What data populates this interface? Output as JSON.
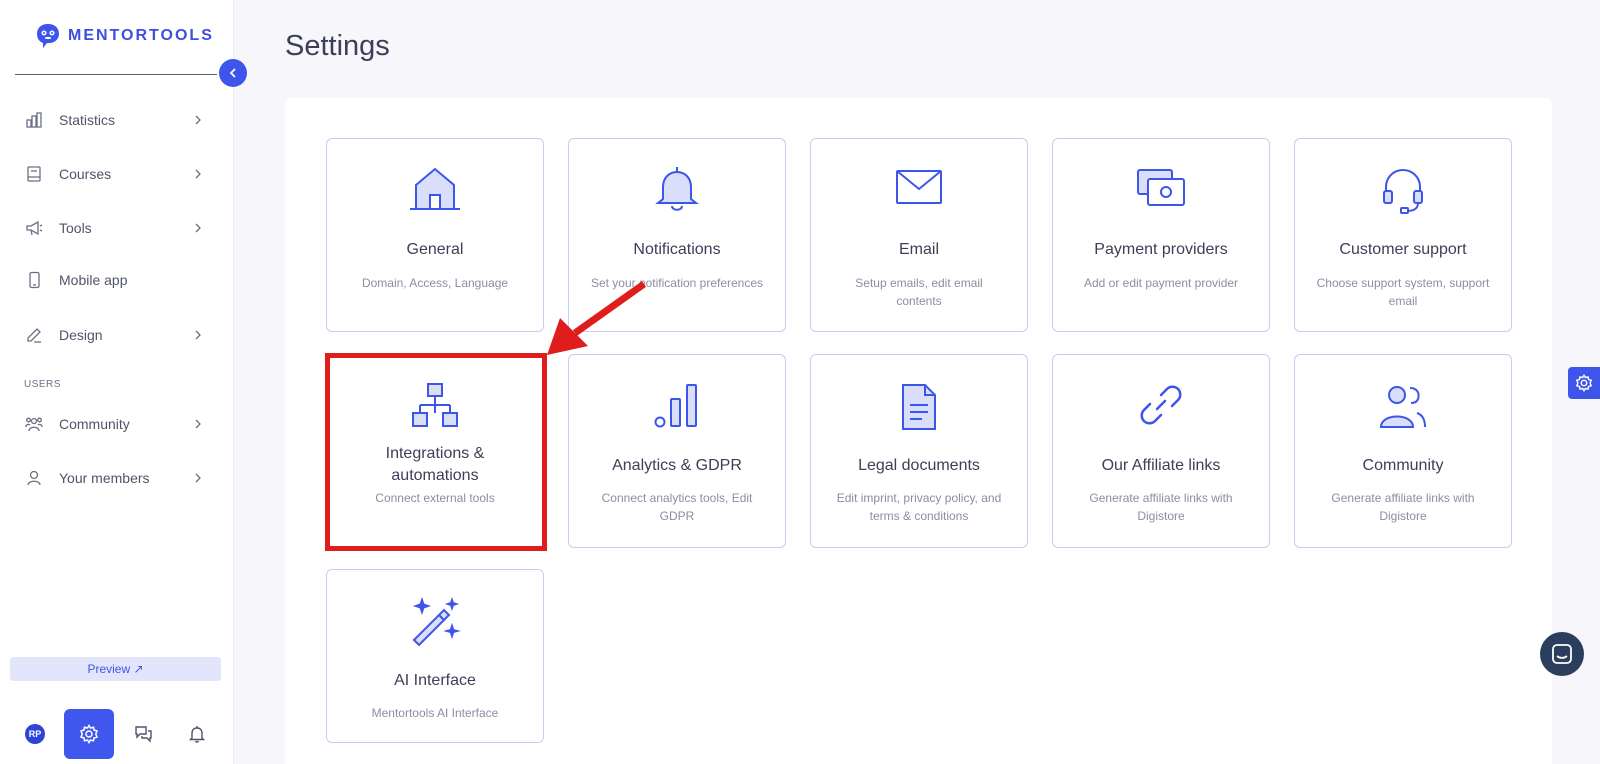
{
  "app": {
    "logo_text": "MENTORTOOLS"
  },
  "sidebar": {
    "items": [
      {
        "label": "Statistics",
        "icon": "bar-chart-icon"
      },
      {
        "label": "Courses",
        "icon": "book-icon"
      },
      {
        "label": "Tools",
        "icon": "megaphone-icon"
      },
      {
        "label": "Mobile app",
        "icon": "smartphone-icon"
      },
      {
        "label": "Design",
        "icon": "pencil-icon"
      }
    ],
    "section_users": "USERS",
    "user_items": [
      {
        "label": "Community",
        "icon": "people-icon"
      },
      {
        "label": "Your members",
        "icon": "user-icon"
      }
    ],
    "preview_label": "Preview ↗",
    "avatar_initials": "RP"
  },
  "main": {
    "title": "Settings",
    "cards": [
      {
        "title": "General",
        "desc": "Domain, Access, Language",
        "icon": "home-icon"
      },
      {
        "title": "Notifications",
        "desc": "Set your notification preferences",
        "icon": "bell-icon"
      },
      {
        "title": "Email",
        "desc": "Setup emails, edit email contents",
        "icon": "envelope-icon"
      },
      {
        "title": "Payment providers",
        "desc": "Add or edit payment provider",
        "icon": "cash-icon"
      },
      {
        "title": "Customer support",
        "desc": "Choose support system, support email",
        "icon": "headset-icon"
      },
      {
        "title": "Integrations & automations",
        "desc": "Connect external tools",
        "icon": "sitemap-icon"
      },
      {
        "title": "Analytics & GDPR",
        "desc": "Connect analytics tools, Edit GDPR",
        "icon": "chart-bars-icon"
      },
      {
        "title": "Legal documents",
        "desc": "Edit imprint, privacy policy, and terms & conditions",
        "icon": "document-icon"
      },
      {
        "title": "Our Affiliate links",
        "desc": "Generate affiliate links with Digistore",
        "icon": "link-icon"
      },
      {
        "title": "Community",
        "desc": "Generate affiliate links with Digistore",
        "icon": "users-icon"
      },
      {
        "title": "AI Interface",
        "desc": "Mentortools AI Interface",
        "icon": "magic-wand-icon"
      }
    ]
  },
  "colors": {
    "accent": "#3d55ea",
    "highlight": "#e01d1d"
  }
}
